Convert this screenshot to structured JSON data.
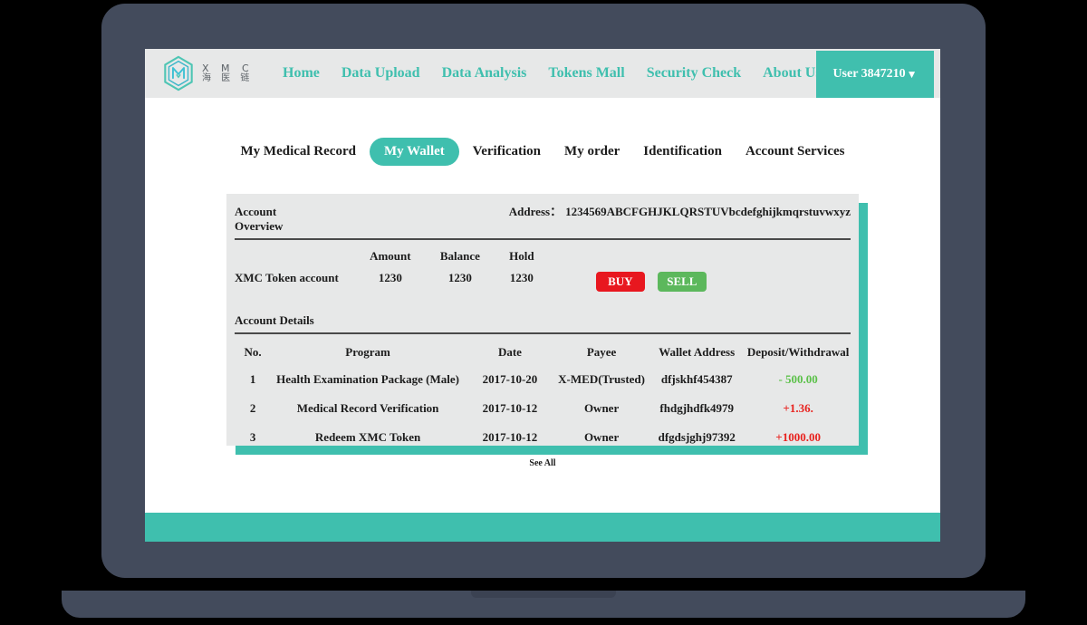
{
  "header": {
    "brand": {
      "logo_icon": "hexagon-m-logo-icon",
      "latin": "X M C",
      "cjk": "海 医 链"
    },
    "nav": [
      {
        "label": "Home"
      },
      {
        "label": "Data Upload"
      },
      {
        "label": "Data Analysis"
      },
      {
        "label": "Tokens Mall"
      },
      {
        "label": "Security Check"
      },
      {
        "label": "About Us"
      }
    ],
    "user": {
      "label": "User 3847210",
      "caret_icon": "chevron-down-icon",
      "caret": "▼"
    }
  },
  "sub_nav": {
    "items": [
      {
        "label": "My Medical Record",
        "active": false
      },
      {
        "label": "My Wallet",
        "active": true
      },
      {
        "label": "Verification",
        "active": false
      },
      {
        "label": "My order",
        "active": false
      },
      {
        "label": "Identification",
        "active": false
      },
      {
        "label": "Account Services",
        "active": false
      }
    ]
  },
  "account_overview": {
    "title": "Account Overview",
    "address_label": "Address：",
    "address_value": "1234569ABCFGHJKLQRSTUVbcdefghijkmqrstuvwxyz",
    "columns": [
      "Amount",
      "Balance",
      "Hold"
    ],
    "row": {
      "name": "XMC Token account",
      "amount": "1230",
      "balance": "1230",
      "hold": "1230"
    },
    "buy_label": "BUY",
    "sell_label": "SELL"
  },
  "account_details": {
    "title": "Account Details",
    "columns": [
      "No.",
      "Program",
      "Date",
      "Payee",
      "Wallet Address",
      "Deposit/Withdrawal"
    ],
    "rows": [
      {
        "no": "1",
        "program": "Health Examination Package (Male)",
        "date": "2017-10-20",
        "payee": "X-MED(Trusted)",
        "wallet": "dfjskhf454387",
        "amount": "- 500.00",
        "amount_sign": "negative"
      },
      {
        "no": "2",
        "program": "Medical Record Verification",
        "date": "2017-10-12",
        "payee": "Owner",
        "wallet": "fhdgjhdfk4979",
        "amount": "+1.36.",
        "amount_sign": "positive"
      },
      {
        "no": "3",
        "program": "Redeem XMC Token",
        "date": "2017-10-12",
        "payee": "Owner",
        "wallet": "dfgdsjghj97392",
        "amount": "+1000.00",
        "amount_sign": "positive"
      }
    ],
    "see_all_label": "See All"
  },
  "colors": {
    "teal": "#3fbfae",
    "header_gray": "#e7e8e8",
    "frame_slate": "#434b5c",
    "buy_red": "#e8171f",
    "sell_green": "#5cb85c",
    "amount_green": "#5cc14a",
    "amount_red": "#e8231f"
  }
}
